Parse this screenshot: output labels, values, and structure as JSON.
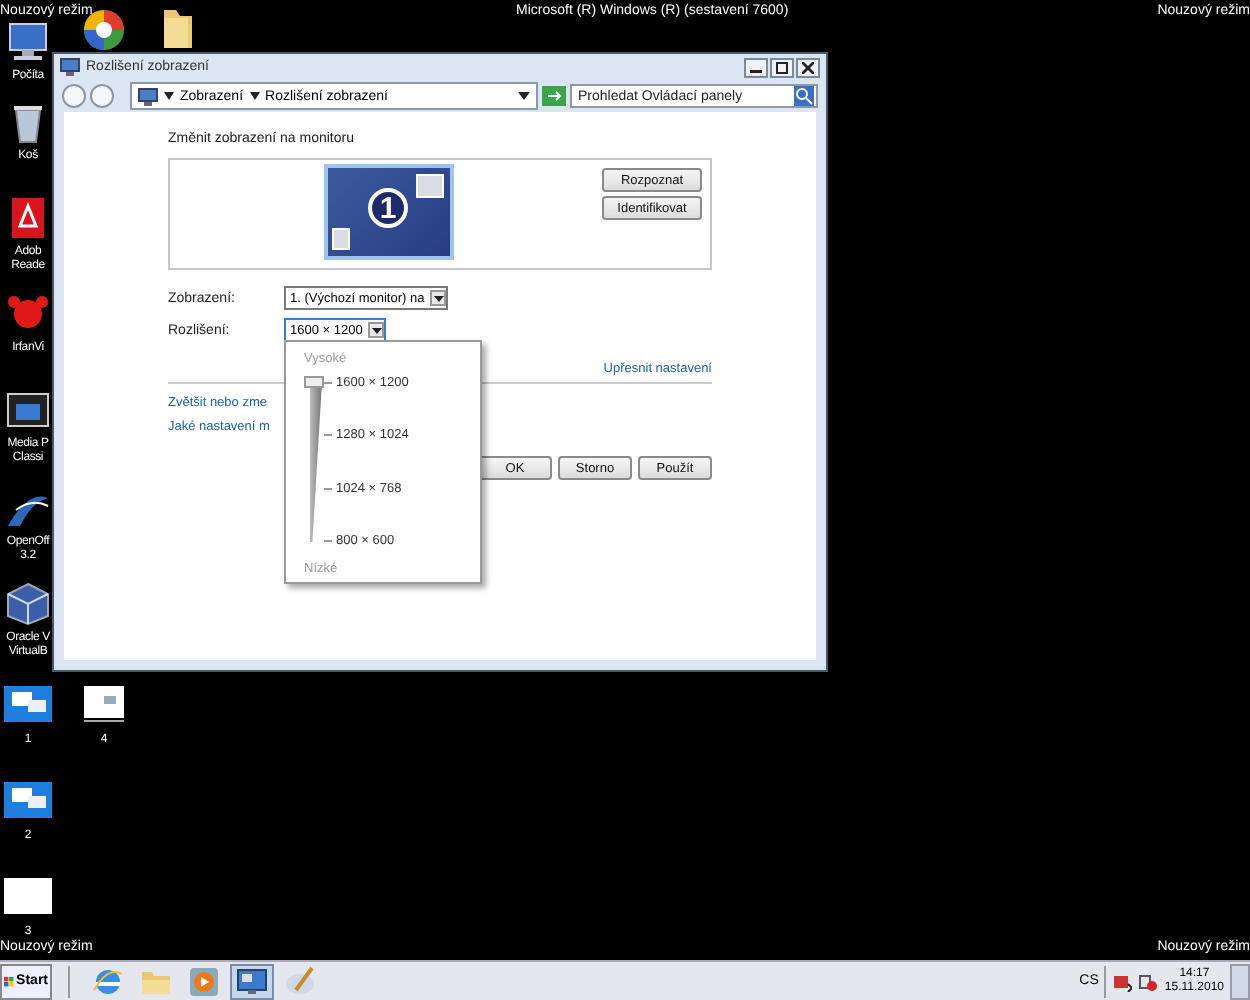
{
  "desktop": {
    "corner_labels": [
      "Nouzový režim",
      "Nouzový režim",
      "Nouzový režim",
      "Nouzový režim"
    ],
    "build_label": "Microsoft (R) Windows (R) (sestavení 7600)",
    "icons": [
      {
        "kind": "computer",
        "lines": [
          "Počíta"
        ]
      },
      {
        "kind": "pinwheel"
      },
      {
        "kind": "folder"
      },
      {
        "kind": "recycle",
        "lines": [
          "Koš"
        ]
      },
      {
        "kind": "pdf",
        "lines": [
          "Adob",
          "Reade"
        ]
      },
      {
        "kind": "irfan",
        "lines": [
          "IrfanVi"
        ]
      },
      {
        "kind": "media",
        "lines": [
          "Media P",
          "Classi"
        ]
      },
      {
        "kind": "office",
        "lines": [
          "OpenOff",
          "3.2"
        ]
      },
      {
        "kind": "vbox",
        "lines": [
          "Oracle V",
          "VirtualB"
        ]
      },
      {
        "kind": "blue-shot",
        "lines": [
          "1"
        ]
      },
      {
        "kind": "white-shot",
        "lines": [
          "4"
        ]
      },
      {
        "kind": "blue-shot",
        "lines": [
          "2"
        ]
      },
      {
        "kind": "blank-shot",
        "lines": [
          "3"
        ]
      }
    ]
  },
  "window": {
    "title": "Rozlišení zobrazení",
    "breadcrumb": [
      "Zobrazení",
      "Rozlišení zobrazení"
    ],
    "search": {
      "placeholder": "Prohledat Ovládací panely"
    }
  },
  "content": {
    "heading": "Změnit zobrazení na monitoru",
    "monitors": [
      {
        "number": "1",
        "selected": true
      }
    ],
    "preview_buttons": [
      "Rozpoznat",
      "Identifikovat"
    ],
    "fields": [
      {
        "label": "Zobrazení:",
        "value": "1. (Výchozí monitor) na",
        "expanded": false
      },
      {
        "label": "Rozlišení:",
        "value": "1600 × 1200",
        "expanded": true,
        "popup": {
          "high_label": "Vysoké",
          "low_label": "Nízké",
          "ticks": [
            "1600 × 1200",
            "1280 × 1024",
            "1024 × 768",
            "800 × 600"
          ],
          "level": 1
        }
      }
    ],
    "advanced_link": "Upřesnit nastavení",
    "links": [
      "Zvětšit nebo zme",
      "Jaké nastavení m"
    ],
    "buttons": [
      "OK",
      "Storno",
      "Použít"
    ]
  },
  "taskbar": {
    "start": "Start",
    "apps": [
      {
        "kind": "browser",
        "selected": false
      },
      {
        "kind": "folder",
        "selected": false
      },
      {
        "kind": "player",
        "selected": false
      },
      {
        "kind": "display",
        "selected": true
      },
      {
        "kind": "paint",
        "selected": false
      }
    ],
    "language": "CS",
    "clock": {
      "time": "14:17",
      "date": "15.11.2010"
    }
  }
}
